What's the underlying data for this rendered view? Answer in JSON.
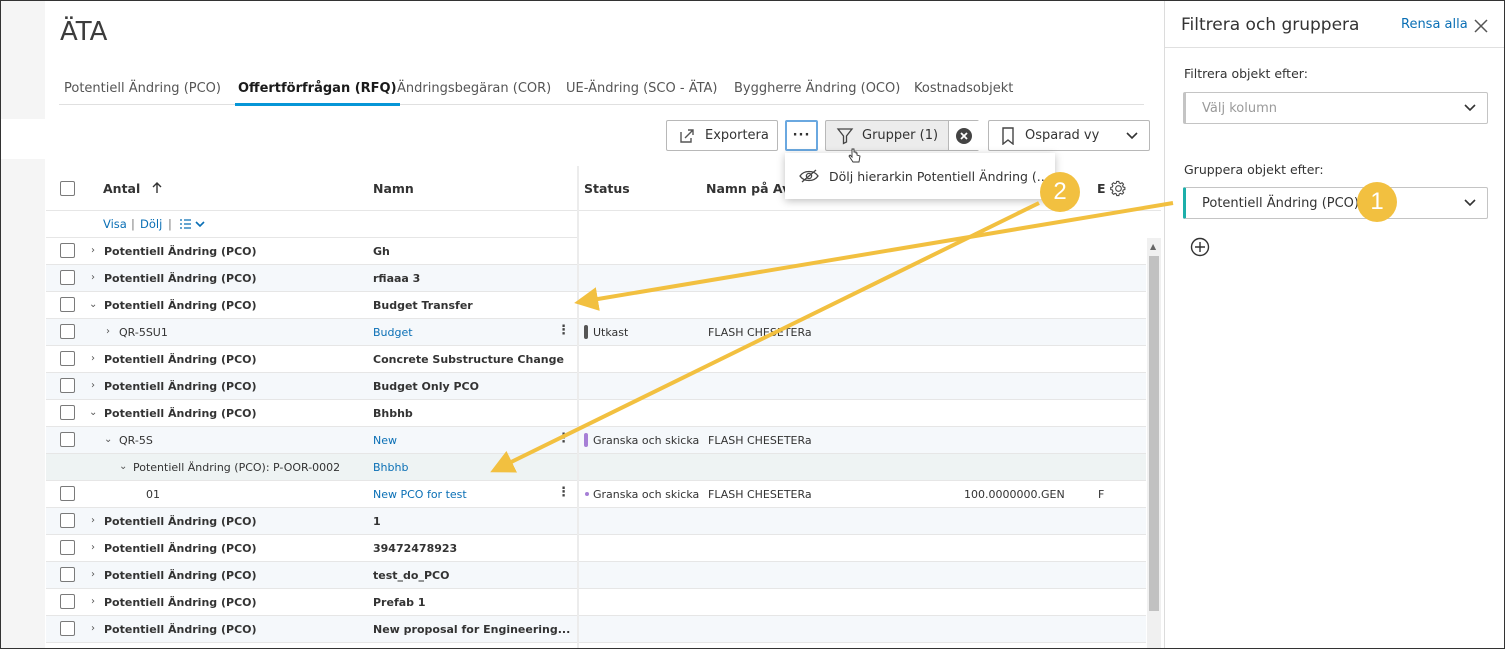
{
  "page": {
    "title": "ÄTA"
  },
  "tabs": [
    {
      "label": "Potentiell Ändring (PCO)"
    },
    {
      "label": "Offertförfrågan (RFQ)"
    },
    {
      "label": "Ändringsbegäran (COR)"
    },
    {
      "label": "UE-Ändring (SCO - ÄTA)"
    },
    {
      "label": "Byggherre Ändring (OCO)"
    },
    {
      "label": "Kostnadsobjekt"
    }
  ],
  "toolbar": {
    "export_label": "Exportera",
    "more_label": "···",
    "group_label": "Grupper (1)",
    "view_label": "Osparad vy"
  },
  "dropdown": {
    "item_label": "Dölj hierarkin Potentiell Ändring (..."
  },
  "grid": {
    "columns": {
      "antal": "Antal",
      "namn": "Namn",
      "status": "Status",
      "avtal": "Namn på Avta",
      "e": "E"
    },
    "subheader": {
      "show": "Visa",
      "sep": "|",
      "hide": "Dölj",
      "sep2": "|"
    },
    "rows": [
      {
        "antal": "Potentiell Ändring (PCO)",
        "namn": "Gh"
      },
      {
        "antal": "Potentiell Ändring (PCO)",
        "namn": "rfiaaa 3"
      },
      {
        "antal": "Potentiell Ändring (PCO)",
        "namn": "Budget Transfer"
      },
      {
        "antal": "QR-5SU1",
        "namn": "Budget",
        "status": "Utkast",
        "avtal": "FLASH CHESETERabc"
      },
      {
        "antal": "Potentiell Ändring (PCO)",
        "namn": "Concrete Substructure Change"
      },
      {
        "antal": "Potentiell Ändring (PCO)",
        "namn": "Budget Only PCO"
      },
      {
        "antal": "Potentiell Ändring (PCO)",
        "namn": "Bhbhb"
      },
      {
        "antal": "QR-5S",
        "namn": "New",
        "status": "Granska och skicka in",
        "avtal": "FLASH CHESETERabc"
      },
      {
        "antal": "Potentiell Ändring (PCO): P-OOR-0002",
        "namn": "Bhbhb"
      },
      {
        "antal": "01",
        "namn": "New PCO for test",
        "status": "Granska och skicka in",
        "avtal": "FLASH CHESETERa...",
        "amount": "100.0000000.GEN",
        "e": "F"
      },
      {
        "antal": "Potentiell Ändring (PCO)",
        "namn": "1"
      },
      {
        "antal": "Potentiell Ändring (PCO)",
        "namn": "39472478923"
      },
      {
        "antal": "Potentiell Ändring (PCO)",
        "namn": "test_do_PCO"
      },
      {
        "antal": "Potentiell Ändring (PCO)",
        "namn": "Prefab 1"
      },
      {
        "antal": "Potentiell Ändring (PCO)",
        "namn": "New proposal for Engineering..."
      }
    ]
  },
  "side_panel": {
    "title": "Filtrera och gruppera",
    "clear_all": "Rensa alla",
    "filter_label": "Filtrera objekt efter:",
    "filter_placeholder": "Välj kolumn",
    "group_label": "Gruppera objekt efter:",
    "group_value": "Potentiell Ändring (PCO)"
  },
  "callouts": {
    "one": "1",
    "two": "2"
  },
  "colors": {
    "accent": "#0696d7",
    "link": "#0a6fb5",
    "callout": "#f2c040",
    "group_border": "#1dafaa",
    "status_draft": "#555555",
    "status_review": "#a67fd6"
  }
}
